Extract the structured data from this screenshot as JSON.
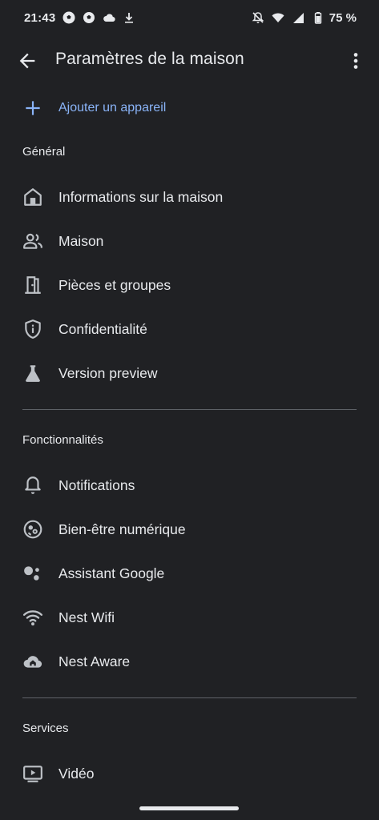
{
  "status_bar": {
    "time": "21:43",
    "left_icons": [
      "soccer-ball-icon",
      "soccer-ball-icon",
      "cloud-icon",
      "download-icon"
    ],
    "right_icons": [
      "notifications-off-icon",
      "wifi-icon",
      "signal-icon",
      "battery-icon"
    ],
    "battery": "75 %"
  },
  "app_bar": {
    "title": "Paramètres de la maison",
    "back_icon": "arrow-back-icon",
    "more_icon": "more-vert-icon"
  },
  "add_device": {
    "label": "Ajouter un appareil",
    "icon": "plus-icon",
    "color": "#8ab4f8"
  },
  "sections": {
    "general": {
      "header": "Général",
      "items": [
        {
          "label": "Informations sur la maison",
          "icon": "home-icon"
        },
        {
          "label": "Maison",
          "icon": "people-icon"
        },
        {
          "label": "Pièces et groupes",
          "icon": "door-icon"
        },
        {
          "label": "Confidentialité",
          "icon": "shield-icon"
        },
        {
          "label": "Version preview",
          "icon": "flask-icon"
        }
      ]
    },
    "features": {
      "header": "Fonctionnalités",
      "items": [
        {
          "label": "Notifications",
          "icon": "bell-icon"
        },
        {
          "label": "Bien-être numérique",
          "icon": "digital-wellbeing-icon"
        },
        {
          "label": "Assistant Google",
          "icon": "assistant-icon"
        },
        {
          "label": "Nest Wifi",
          "icon": "wifi-icon"
        },
        {
          "label": "Nest Aware",
          "icon": "cloud-home-icon"
        }
      ]
    },
    "services": {
      "header": "Services",
      "items": [
        {
          "label": "Vidéo",
          "icon": "video-icon"
        }
      ]
    }
  },
  "colors": {
    "background": "#202124",
    "text": "#e8eaed",
    "icon": "#bdc1c6",
    "accent": "#8ab4f8",
    "divider": "#5f6368"
  }
}
